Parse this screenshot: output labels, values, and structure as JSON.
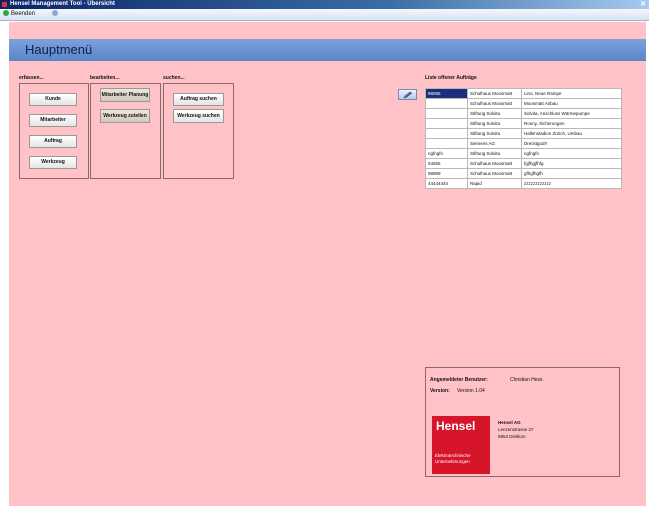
{
  "window": {
    "title": "Hensel Management Tool - Übersicht",
    "close": "✕"
  },
  "toolbar": {
    "exit_label": "Beenden"
  },
  "header": {
    "title": "Hauptmenü"
  },
  "groups": {
    "erfassen": {
      "label": "erfassen...",
      "buttons": [
        "Kunde",
        "Mitarbeiter",
        "Auftrag",
        "Werkzeug"
      ]
    },
    "bearbeiten": {
      "label": "bearbeiten...",
      "buttons": [
        "Mitarbeiter Planung",
        "Werkzeug zuteilen"
      ]
    },
    "suchen": {
      "label": "suchen...",
      "buttons": [
        "Auftrag suchen",
        "Werkzeug suchen"
      ]
    }
  },
  "orders": {
    "title": "Liste offener Aufträge",
    "rows": [
      [
        "99055",
        "Schulhaus Moosmatt",
        "Lino, Neue Rampe"
      ],
      [
        "",
        "Schulhaus Moosmatt",
        "Moosmatt Anbau"
      ],
      [
        "",
        "Stiftung Solvita",
        "Solvita, Anschluss Wärmepumpe"
      ],
      [
        "",
        "Stiftung Solvita",
        "Ronny, Sicherungen"
      ],
      [
        "",
        "Stiftung Solvita",
        "Hallenstadion Zürich, Umbau"
      ],
      [
        "",
        "Siemens AG",
        "Drecktgod!!"
      ],
      [
        "ngfngfn",
        "Stiftung Solvita",
        "ngfngfn"
      ],
      [
        "54555",
        "Schulhaus Moosmatt",
        "fgjfhgjfhfg"
      ],
      [
        "98989",
        "Schulhaus Moosmatt",
        "gfhgfhgfh"
      ],
      [
        "44444444",
        "Rapid",
        "zzzzzzzzzzzz"
      ]
    ]
  },
  "info": {
    "user_label": "Angemeldeter Benutzer:",
    "user_value": "Christian Hess",
    "version_label": "Version:",
    "version_value": "Version 1.04",
    "logo_name": "Hensel",
    "logo_sub": "Elektrotechnische Unternehmungen",
    "company": "Hensel AG",
    "street": "Lenzenstrasse 27",
    "city": "8953 Dietikon"
  }
}
